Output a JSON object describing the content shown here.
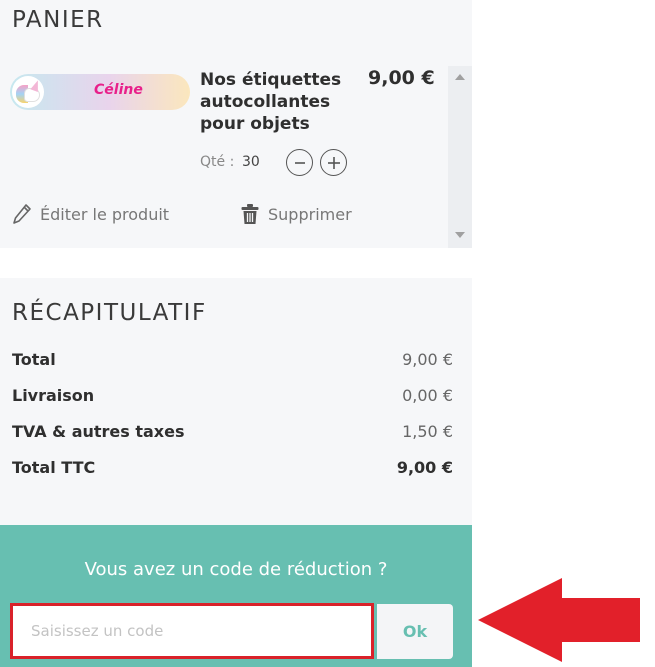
{
  "cart": {
    "title": "PANIER",
    "item": {
      "thumbnail_name": "Céline",
      "name": "Nos étiquettes autocollantes pour objets",
      "price": "9,00 €",
      "qty_label": "Qté :",
      "qty_value": "30"
    },
    "edit_label": "Éditer le produit",
    "delete_label": "Supprimer"
  },
  "summary": {
    "title": "RÉCAPITULATIF",
    "rows": [
      {
        "label": "Total",
        "value": "9,00 €"
      },
      {
        "label": "Livraison",
        "value": "0,00 €"
      },
      {
        "label": "TVA & autres taxes",
        "value": "1,50 €"
      },
      {
        "label": "Total TTC",
        "value": "9,00 €"
      }
    ]
  },
  "promo": {
    "question": "Vous avez un code de réduction ?",
    "placeholder": "Saisissez un code",
    "submit_label": "Ok"
  },
  "colors": {
    "accent_teal": "#67bfb1",
    "highlight_red": "#d9222a",
    "arrow_red": "#e2202a"
  }
}
